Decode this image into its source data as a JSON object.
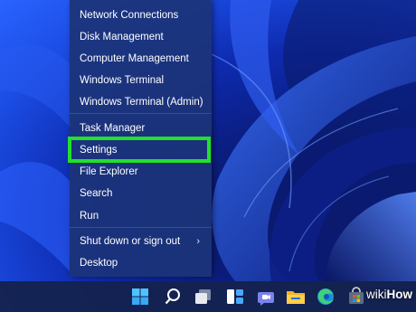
{
  "menu": {
    "items": [
      {
        "label": "Network Connections"
      },
      {
        "label": "Disk Management"
      },
      {
        "label": "Computer Management"
      },
      {
        "label": "Windows Terminal"
      },
      {
        "label": "Windows Terminal (Admin)"
      },
      {
        "label": "Task Manager"
      },
      {
        "label": "Settings"
      },
      {
        "label": "File Explorer"
      },
      {
        "label": "Search"
      },
      {
        "label": "Run"
      },
      {
        "label": "Shut down or sign out",
        "chevron": "›"
      },
      {
        "label": "Desktop"
      }
    ],
    "highlighted_item": "Settings",
    "highlight_color": "#22e02b"
  },
  "taskbar": {
    "icons": [
      "windows-start-icon",
      "search-icon",
      "task-view-icon",
      "widgets-icon",
      "teams-chat-icon",
      "file-explorer-icon",
      "edge-browser-icon",
      "store-icon"
    ]
  },
  "watermark": {
    "wiki": "wiki",
    "how": "How"
  }
}
